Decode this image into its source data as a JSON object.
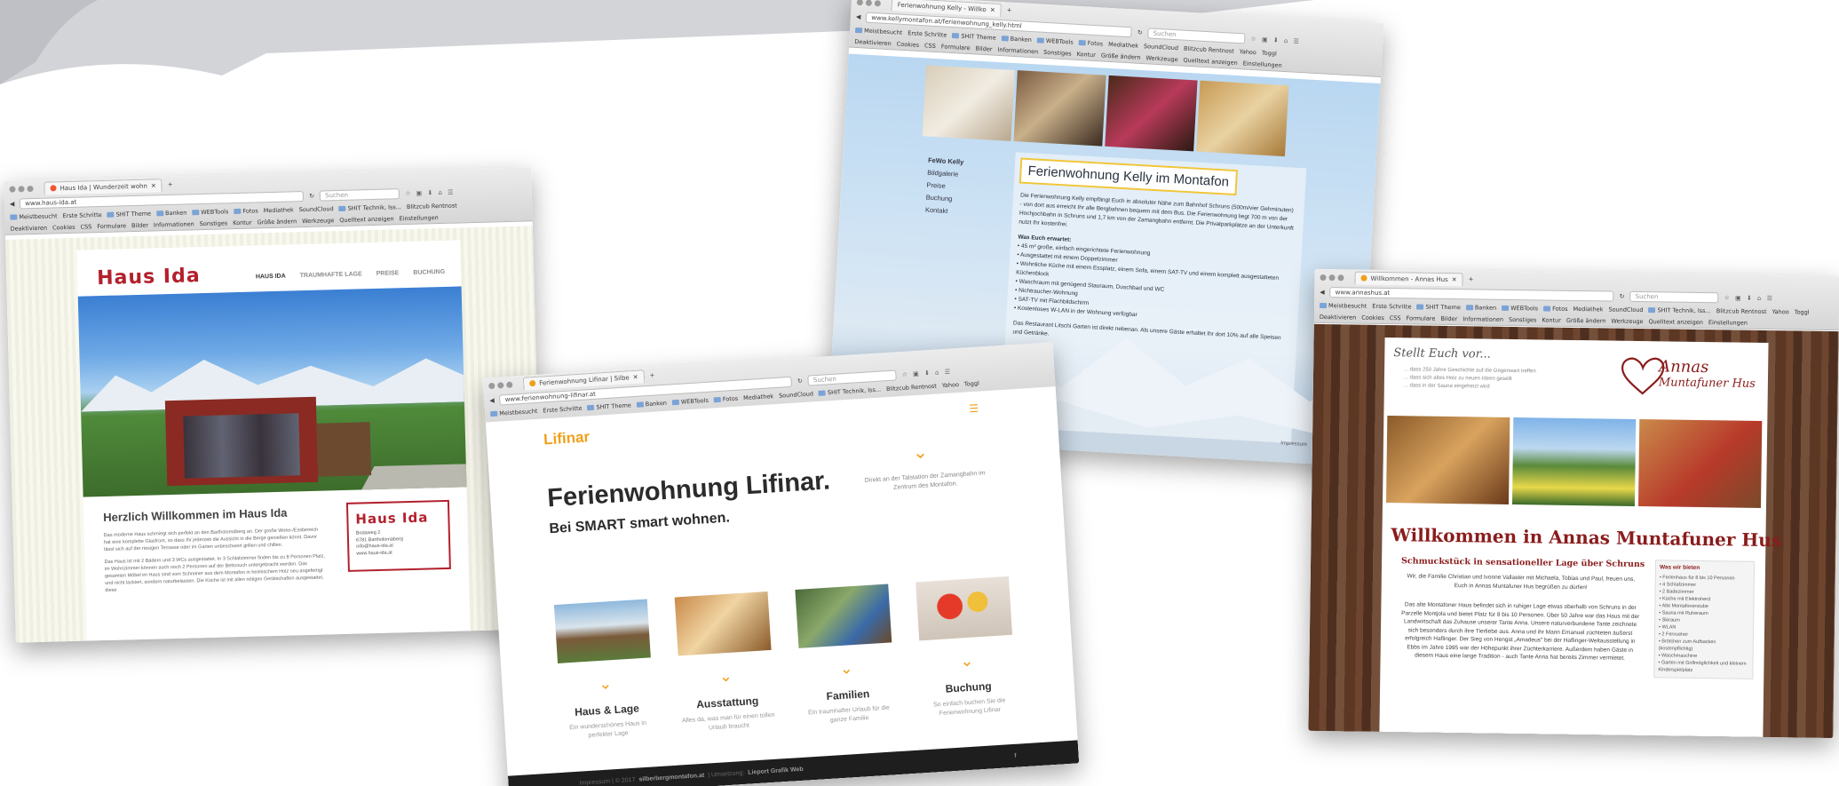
{
  "common": {
    "bookmarks": [
      "Meistbesucht",
      "Erste Schritte",
      "SHIT Theme",
      "Banken",
      "WEBTools",
      "Fotos",
      "Mediathek",
      "SoundCloud",
      "SHIT Technik, Iss...",
      "Blitzcub Rentnost",
      "Yahoo",
      "Toggl"
    ],
    "toolbar2": [
      "Deaktivieren",
      "Cookies",
      "CSS",
      "Formulare",
      "Bilder",
      "Informationen",
      "Sonstiges",
      "Kontur",
      "Größe ändern",
      "Werkzeuge",
      "Quelltext anzeigen",
      "Einstellungen"
    ],
    "search_placeholder": "Suchen"
  },
  "windows": {
    "ida": {
      "tab_title": "Haus Ida | Wunderzeit wohn",
      "url": "www.haus-ida.at",
      "logo": "Haus Ida",
      "nav": [
        "HAUS IDA",
        "TRAUMHAFTE LAGE",
        "PREISE",
        "BUCHUNG"
      ],
      "heading": "Herzlich Willkommen im Haus Ida",
      "paragraph1": "Das moderne Haus schmiegt sich perfekt an den Bartholomäberg an. Der große Wohn-/Essbereich hat eine komplette Glasfront, so dass Ihr jederzeit die Aussicht in die Berge genießen könnt. Davor lässt sich auf der riesigen Terrasse oder im Garten unbeschwert grillen und chillen.",
      "paragraph2": "Das Haus ist mit 2 Bädern und 3 WCs ausgestattet. In 3 Schlafzimmer finden bis zu 8 Personen Platz, im Wohnzimmer können auch noch 2 Personen auf der Bettcouch untergebracht werden. Das gesamten Möbel im Haus sind vom Schreiner aus dem Montafon in heimischem Holz neu angefertigt und nicht lackiert, sondern naturbelassen. Die Küche ist mit allen nötigen Gerätschaften ausgestattet, diese",
      "card": {
        "logo": "Haus Ida",
        "lines": [
          "Bodaweg 2",
          "6781 Bartholomäberg",
          "info@haus-ida.at",
          "www.haus-ida.at"
        ]
      }
    },
    "lifinar": {
      "tab_title": "Ferienwohnung Lifinar | Silbe",
      "url": "www.ferienwohnung-lifinar.at",
      "logo": "Lifinar",
      "heading": "Ferienwohnung Lifinar.",
      "subheading": "Bei SMART smart wohnen.",
      "tagline": "Direkt an der Talstation der Zamangbahn im Zentrum des Montafon.",
      "features": [
        {
          "title": "Haus & Lage",
          "text": "Ein wunderschönes Haus in perfekter Lage"
        },
        {
          "title": "Ausstattung",
          "text": "Alles da, was man für einen tollen Urlaub braucht"
        },
        {
          "title": "Familien",
          "text": "Ein traumhafter Urlaub für die ganze Familie"
        },
        {
          "title": "Buchung",
          "text": "So einfach buchen Sie die Ferienwohnung Lifinar"
        }
      ],
      "footer_left": "Impressum | © 2017",
      "footer_domain": "silberbergmontafon.at",
      "footer_mid": "| Umsetzung:",
      "footer_right": "Lieport Grafik Web"
    },
    "kelly": {
      "tab_title": "Ferienwohnung Kelly - Willko",
      "url": "www.kellymontafon.at/ferienwohnung_kelly.html",
      "nav": [
        "FeWo Kelly",
        "Bildgalerie",
        "Preise",
        "Buchung",
        "Kontakt"
      ],
      "title": "Ferienwohnung Kelly im Montafon",
      "intro": "Die Ferienwohnung Kelly empfängt Euch in absoluter Nähe zum Bahnhof Schruns (500m/vier Gehminuten) - von dort aus erreicht Ihr alle Bergbahnen bequem mit dem Bus. Die Ferienwohnung liegt 700 m von der Hochjochbahn in Schruns und 1,7 km von der Zamangbahn entfernt. Die Privatparkplätze an der Unterkunft nutzt Ihr kostenfrei.",
      "subheading": "Was Euch erwartet:",
      "items": [
        "• 45 m² große, einfach eingerichtete Ferienwohnung",
        "• Ausgestattet mit einem Doppelzimmer",
        "• Wohnliche Küche mit einem Essplatz, einem Sofa, einem SAT-TV und einem komplett ausgestatteten Küchenblock",
        "• Waschraum mit genügend Stauraum, Duschbad und WC",
        "• Nichtraucher-Wohnung",
        "• SAT-TV mit Flachbildschirm",
        "• Kostenloses W-LAN in der Wohnung verfügbar"
      ],
      "outro": "Das Restaurant Litschi Garten ist direkt nebenan. Als unsere Gäste erhaltet Ihr dort 10% auf alle Speisen und Getränke.",
      "footer": "Impressum"
    },
    "annas": {
      "tab_title": "Willkommen - Annas Hus",
      "url": "www.annashus.at",
      "stellt": "Stellt Euch vor...",
      "lines": [
        "... dass 250 Jahre Geschichte auf die Gegenwart treffen",
        "... dass sich altes Holz zu neuen Ideen gesellt",
        "... dass in der Sauna eingeheizt wird"
      ],
      "logo_a": "Annas",
      "logo_b": "Muntafuner Hus",
      "heading": "Willkommen in Annas Muntafuner Hus",
      "subheading": "Schmuckstück in sensationeller Lage über Schruns",
      "p1": "Wir, die Familie Christian und Ivonne Vallaster mit Michaela, Tobias und Paul, freuen uns, Euch in Annas Muntafuner Hus begrüßen zu dürfen!",
      "p2": "Das alte Montafoner Haus befindet sich in ruhiger Lage etwas oberhalb von Schruns in der Parzelle Montjola und bietet Platz für 8 bis 10 Personen. Über 50 Jahre war das Haus mit der Landwirtschaft das Zuhause unserer Tante Anna. Unsere naturverbundene Tante zeichnete sich besonders durch ihre Tierliebe aus. Anna und ihr Mann Emanuel züchteten äußerst erfolgreich Haflinger. Der Sieg von Hengst „Amadeus\" bei der Haflinger-Weltausstellung in Ebbs im Jahre 1995 war der Höhepunkt ihrer Züchterkarriere. Außerdem haben Gäste in diesem Haus eine lange Tradition - auch Tante Anna hat bereits Zimmer vermietet.",
      "side_title": "Was wir bieten",
      "side_items": [
        "• Ferienhaus für 8 bis 10 Personen",
        "• 4 Schlafzimmer",
        "• 2 Badezimmer",
        "• Küche mit Elektroherd",
        "• Alte Montafonerstube",
        "• Sauna mit Ruheraum",
        "• Skiraum",
        "• WLAN",
        "• 2 Fernseher",
        "• Brötchen zum Aufbacken (kostenpflichtig)",
        "• Waschmaschine",
        "• Garten mit Grillmöglichkeit und kleinem Kinderspielplatz"
      ]
    }
  }
}
